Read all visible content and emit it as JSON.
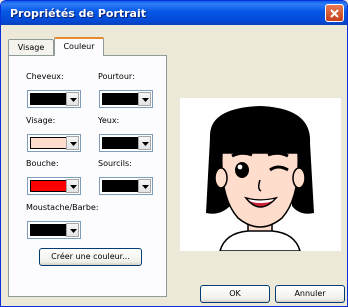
{
  "window": {
    "title": "Propriétés de Portrait"
  },
  "tabs": [
    {
      "label": "Visage"
    },
    {
      "label": "Couleur"
    }
  ],
  "colors": {
    "cheveux": "#000000",
    "pourtour": "#000000",
    "visage": "#FFDDCC",
    "yeux": "#000000",
    "bouche": "#FF0000",
    "sourcils": "#000000",
    "moustache": "#000000"
  },
  "fields": {
    "cheveux": "Cheveux:",
    "pourtour": "Pourtour:",
    "visage": "Visage:",
    "yeux": "Yeux:",
    "bouche": "Bouche:",
    "sourcils": "Sourcils:",
    "moustache": "Moustache/Barbe:"
  },
  "buttons": {
    "create_color": "Créer une couleur...",
    "ok": "OK",
    "cancel": "Annuler"
  },
  "preview": {
    "description_icon": "portrait-face-icon"
  }
}
